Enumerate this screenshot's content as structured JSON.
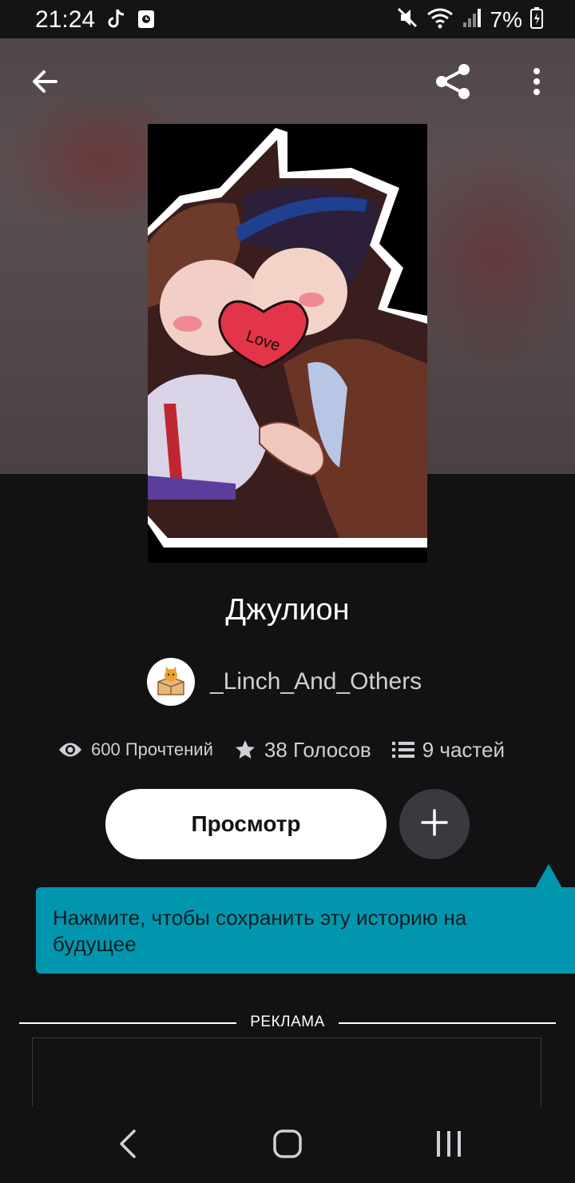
{
  "status_bar": {
    "time": "21:24",
    "battery": "7%",
    "icons": [
      "tiktok-icon",
      "media-icon",
      "mute-icon",
      "wifi-icon",
      "signal-icon",
      "battery-icon"
    ]
  },
  "top_bar": {
    "icons": [
      "back-arrow-icon",
      "share-icon",
      "more-vertical-icon"
    ]
  },
  "cover": {
    "text": "Love"
  },
  "story": {
    "title": "Джулион",
    "author": "_Linch_And_Others"
  },
  "stats": {
    "reads": "600 Прочтений",
    "votes": "38 Голосов",
    "parts": "9 частей"
  },
  "actions": {
    "read_label": "Просмотр",
    "add_icon": "plus-icon"
  },
  "tooltip": {
    "text": "Нажмите, чтобы сохранить эту историю на будущее"
  },
  "ad": {
    "label": "РЕКЛАМА"
  },
  "nav_bar": {
    "icons": [
      "back-chevron-icon",
      "home-icon",
      "recents-icon"
    ]
  },
  "colors": {
    "background": "#121214",
    "tooltip": "#0097ae",
    "button": "#ffffff",
    "add_button": "#3a3a3e"
  }
}
